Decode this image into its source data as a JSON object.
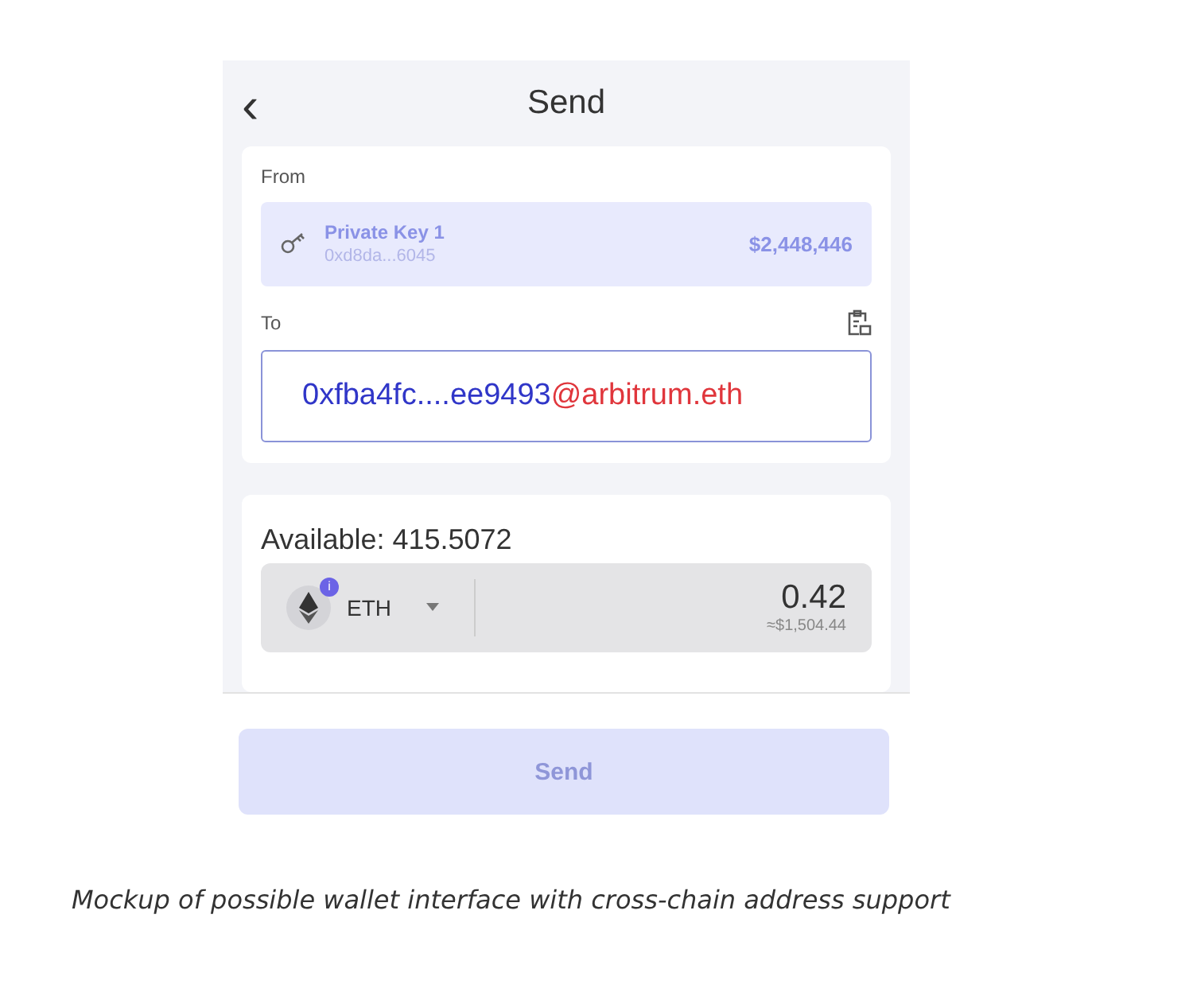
{
  "screen": {
    "title": "Send",
    "back": "‹"
  },
  "from": {
    "label": "From",
    "account_name": "Private Key 1",
    "account_address": "0xd8da...6045",
    "balance": "$2,448,446"
  },
  "to": {
    "label": "To",
    "address": "0xfba4fc....ee9493",
    "domain": "@arbitrum.eth"
  },
  "amount": {
    "available": "Available: 415.5072",
    "token": "ETH",
    "token_badge": "i",
    "value": "0.42",
    "fiat": "≈$1,504.44"
  },
  "send_button": {
    "label": "Send",
    "disabled": true
  },
  "caption": "Mockup of possible wallet interface with cross-chain address support"
}
